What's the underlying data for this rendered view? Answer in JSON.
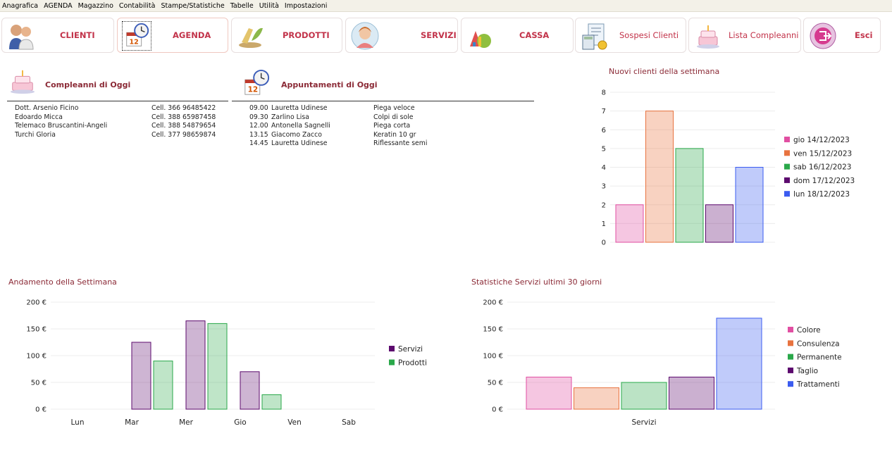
{
  "menu": [
    "Anagrafica",
    "AGENDA",
    "Magazzino",
    "Contabilità",
    "Stampe/Statistiche",
    "Tabelle",
    "Utilità",
    "Impostazioni"
  ],
  "toolbar": [
    {
      "label": "CLIENTI",
      "icon": "clients-icon"
    },
    {
      "label": "AGENDA",
      "icon": "calendar-clock-icon"
    },
    {
      "label": "PRODOTTI",
      "icon": "products-icon"
    },
    {
      "label": "SERVIZI",
      "icon": "services-icon"
    },
    {
      "label": "CASSA",
      "icon": "cash-icon"
    },
    {
      "label": "Sospesi Clienti",
      "icon": "calculator-icon"
    },
    {
      "label": "Lista Compleanni",
      "icon": "cake-icon"
    },
    {
      "label": "Esci",
      "icon": "exit-icon"
    }
  ],
  "birthdays": {
    "title": "Compleanni di Oggi",
    "rows": [
      {
        "name": "Dott. Arsenio Ficino",
        "phone": "Cell. 366 96485422"
      },
      {
        "name": "Edoardo Micca",
        "phone": "Cell. 388 65987458"
      },
      {
        "name": "Telemaco Bruscantini-Angeli",
        "phone": "Cell. 388 54879654"
      },
      {
        "name": "Turchi Gloria",
        "phone": "Cell. 377 98659874"
      }
    ]
  },
  "appointments": {
    "title": "Appuntamenti di Oggi",
    "rows": [
      {
        "time": "09.00",
        "name": "Lauretta Udinese",
        "service": "Piega veloce"
      },
      {
        "time": "09.30",
        "name": "Zarlino Lisa",
        "service": "Colpi di sole"
      },
      {
        "time": "12.00",
        "name": "Antonella Sagnelli",
        "service": "Piega corta"
      },
      {
        "time": "13.15",
        "name": "Giacomo Zacco",
        "service": "Keratin 10 gr"
      },
      {
        "time": "14.45",
        "name": "Lauretta Udinese",
        "service": "Riflessante semi"
      }
    ]
  },
  "colors": {
    "accent": "#c2334a",
    "title": "#8b2a36"
  },
  "chart_data": [
    {
      "type": "bar",
      "title": "Nuovi clienti della settimana",
      "ylim": [
        0,
        8
      ],
      "yticks": [
        "0",
        "1",
        "2",
        "3",
        "4",
        "5",
        "6",
        "7",
        "8"
      ],
      "series": [
        {
          "name": "gio 14/12/2023",
          "values": [
            2
          ],
          "color": "#e14fa2"
        },
        {
          "name": "ven 15/12/2023",
          "values": [
            7
          ],
          "color": "#e8733f"
        },
        {
          "name": "sab 16/12/2023",
          "values": [
            5
          ],
          "color": "#2aa84a"
        },
        {
          "name": "dom 17/12/2023",
          "values": [
            2
          ],
          "color": "#5c0a6e"
        },
        {
          "name": "lun 18/12/2023",
          "values": [
            4
          ],
          "color": "#3b5cf0"
        }
      ],
      "legend": "right",
      "grid": true
    },
    {
      "type": "bar",
      "title": "Andamento della Settimana",
      "categories": [
        "Lun",
        "Mar",
        "Mer",
        "Gio",
        "Ven",
        "Sab"
      ],
      "ylim": [
        0,
        200
      ],
      "yticks": [
        "0 €",
        "50 €",
        "100 €",
        "150 €",
        "200 €"
      ],
      "series": [
        {
          "name": "Servizi",
          "values": [
            0,
            125,
            165,
            70,
            0,
            0
          ],
          "color": "#5c0a6e"
        },
        {
          "name": "Prodotti",
          "values": [
            0,
            90,
            160,
            27,
            0,
            0
          ],
          "color": "#2aa84a"
        }
      ],
      "legend": "right",
      "grid": true
    },
    {
      "type": "bar",
      "title": "Statistiche Servizi ultimi 30 giorni",
      "categories": [
        "Servizi"
      ],
      "ylim": [
        0,
        200
      ],
      "yticks": [
        "0 €",
        "50 €",
        "100 €",
        "150 €",
        "200 €"
      ],
      "series": [
        {
          "name": "Colore",
          "values": [
            60
          ],
          "color": "#e14fa2"
        },
        {
          "name": "Consulenza",
          "values": [
            40
          ],
          "color": "#e8733f"
        },
        {
          "name": "Permanente",
          "values": [
            50
          ],
          "color": "#2aa84a"
        },
        {
          "name": "Taglio",
          "values": [
            60
          ],
          "color": "#5c0a6e"
        },
        {
          "name": "Trattamenti",
          "values": [
            170
          ],
          "color": "#3b5cf0"
        }
      ],
      "legend": "right",
      "grid": true
    }
  ]
}
